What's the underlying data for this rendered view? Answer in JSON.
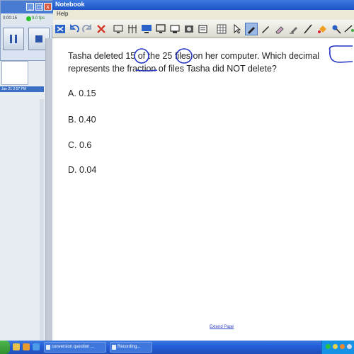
{
  "window": {
    "title": "Notebook",
    "menu": "Help"
  },
  "recorder": {
    "time": "0:00:15",
    "fps": "9.0 fps"
  },
  "sidebar": {
    "thumbnail_label": "Jan 21 2:57 PM"
  },
  "question": {
    "line1_before": "Tasha deleted ",
    "num1": "15",
    "line1_mid1": " of the ",
    "num2": "25",
    "line1_mid2": " files on her computer. Which ",
    "decimal_word": "decimal",
    "line2_before": "represents the ",
    "fraction_word": "fraction",
    "line2_after": " of files Tasha did NOT delete?"
  },
  "answers": [
    {
      "letter": "A.",
      "value": "0.15"
    },
    {
      "letter": "B.",
      "value": "0.40"
    },
    {
      "letter": "C.",
      "value": "0.6"
    },
    {
      "letter": "D.",
      "value": "0.04"
    }
  ],
  "footer": {
    "link": "Extend Page"
  },
  "taskbar": {
    "tasks": [
      "conversion question ...",
      "Recording..."
    ]
  },
  "colors": {
    "ink": "#2233c4",
    "title_bar": "#245edb",
    "taskbar": "#245edb"
  }
}
